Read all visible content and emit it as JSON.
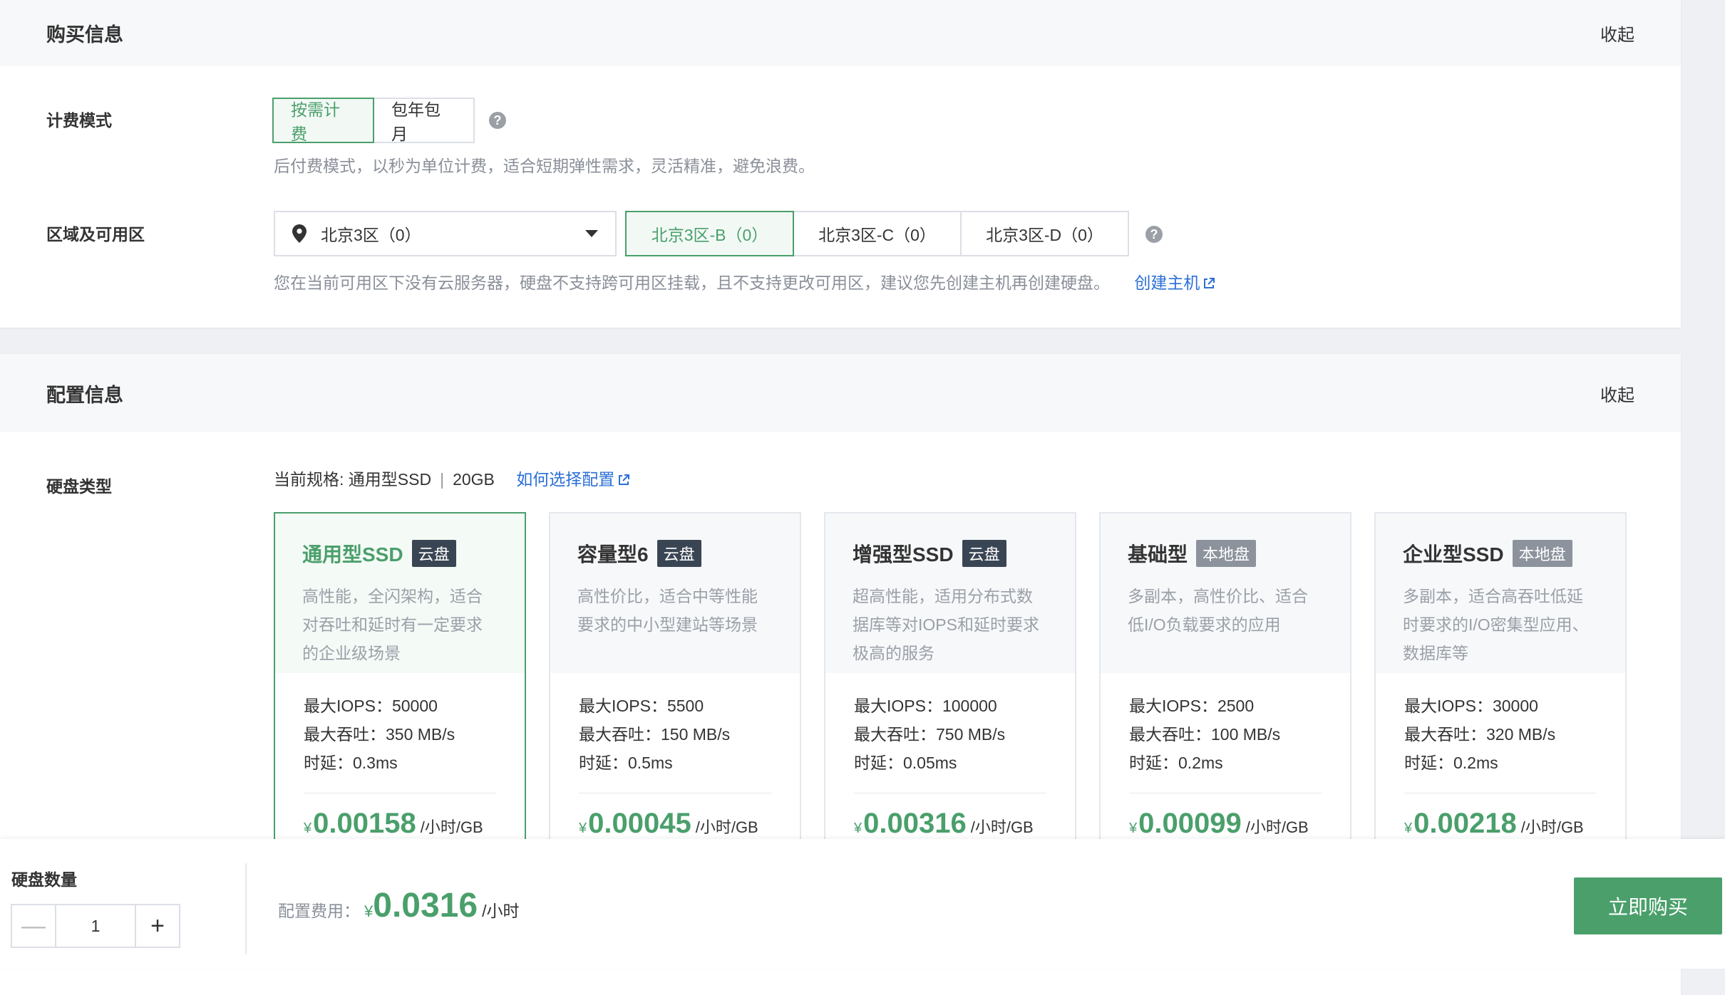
{
  "purchase": {
    "title": "购买信息",
    "collapse_label": "收起",
    "billing": {
      "label": "计费模式",
      "options": [
        "按需计费",
        "包年包月"
      ],
      "selected": "按需计费",
      "hint": "后付费模式，以秒为单位计费，适合短期弹性需求，灵活精准，避免浪费。"
    },
    "region": {
      "label": "区域及可用区",
      "region_value": "北京3区（0）",
      "zones": [
        "北京3区-B（0）",
        "北京3区-C（0）",
        "北京3区-D（0）"
      ],
      "selected_zone": "北京3区-B（0）",
      "hint": "您在当前可用区下没有云服务器，硬盘不支持跨可用区挂载，且不支持更改可用区，建议您先创建主机再创建硬盘。",
      "create_host_link": "创建主机"
    }
  },
  "config": {
    "title": "配置信息",
    "collapse_label": "收起",
    "disk_type": {
      "label": "硬盘类型",
      "current_spec_prefix": "当前规格: 通用型SSD",
      "current_spec_size": "20GB",
      "help_link": "如何选择配置",
      "cards": [
        {
          "name": "通用型SSD",
          "tag": "云盘",
          "tag_kind": "cloud",
          "desc": "高性能，全闪架构，适合对吞吐和延时有一定要求的企业级场景",
          "iops": "最大IOPS：50000",
          "throughput": "最大吞吐：350 MB/s",
          "latency": "时延：0.3ms",
          "currency": "¥",
          "price": "0.00158",
          "unit": "/小时/GB",
          "active": true
        },
        {
          "name": "容量型6",
          "tag": "云盘",
          "tag_kind": "cloud",
          "desc": "高性价比，适合中等性能要求的中小型建站等场景",
          "iops": "最大IOPS：5500",
          "throughput": "最大吞吐：150 MB/s",
          "latency": "时延：0.5ms",
          "currency": "¥",
          "price": "0.00045",
          "unit": "/小时/GB",
          "active": false
        },
        {
          "name": "增强型SSD",
          "tag": "云盘",
          "tag_kind": "cloud",
          "desc": "超高性能，适用分布式数据库等对IOPS和延时要求极高的服务",
          "iops": "最大IOPS：100000",
          "throughput": "最大吞吐：750 MB/s",
          "latency": "时延：0.05ms",
          "currency": "¥",
          "price": "0.00316",
          "unit": "/小时/GB",
          "active": false
        },
        {
          "name": "基础型",
          "tag": "本地盘",
          "tag_kind": "local",
          "desc": "多副本，高性价比、适合低I/O负载要求的应用",
          "iops": "最大IOPS：2500",
          "throughput": "最大吞吐：100 MB/s",
          "latency": "时延：0.2ms",
          "currency": "¥",
          "price": "0.00099",
          "unit": "/小时/GB",
          "active": false
        },
        {
          "name": "企业型SSD",
          "tag": "本地盘",
          "tag_kind": "local",
          "desc": "多副本，适合高吞吐低延时要求的I/O密集型应用、数据库等",
          "iops": "最大IOPS：30000",
          "throughput": "最大吞吐：320 MB/s",
          "latency": "时延：0.2ms",
          "currency": "¥",
          "price": "0.00218",
          "unit": "/小时/GB",
          "active": false
        }
      ]
    }
  },
  "bottom": {
    "qty_label": "硬盘数量",
    "qty_value": "1",
    "minus_symbol": "—",
    "plus_symbol": "+",
    "fee_label": "配置费用：",
    "fee_currency": "¥",
    "fee_value": "0.0316",
    "fee_unit": "/小时",
    "buy_label": "立即购买"
  },
  "colors": {
    "accent": "#4a9f6b",
    "link": "#2b6fd6",
    "tag_cloud": "#3a4554",
    "tag_local": "#8c939d"
  }
}
